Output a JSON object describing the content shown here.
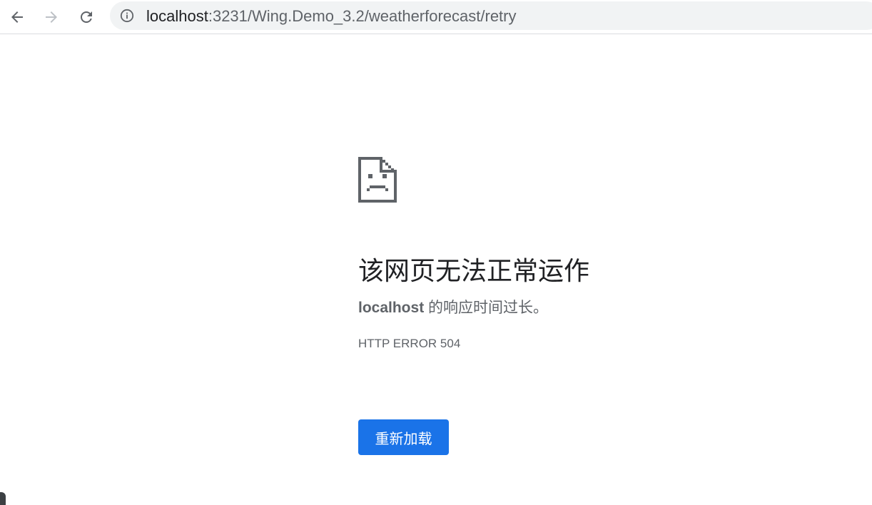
{
  "browser": {
    "url_host": "localhost",
    "url_rest": ":3231/Wing.Demo_3.2/weatherforecast/retry",
    "icons": {
      "back": "arrow-left-icon",
      "forward": "arrow-right-icon",
      "reload": "reload-icon",
      "site_info": "info-icon"
    }
  },
  "error": {
    "icon": "sad-page-icon",
    "title": "该网页无法正常运作",
    "desc_host": "localhost",
    "desc_text": " 的响应时间过长。",
    "code": "HTTP ERROR 504",
    "reload_label": "重新加载"
  },
  "colors": {
    "accent": "#1a73e8",
    "title": "#202124",
    "secondary": "#5f6368",
    "omnibox_bg": "#f1f3f4"
  }
}
